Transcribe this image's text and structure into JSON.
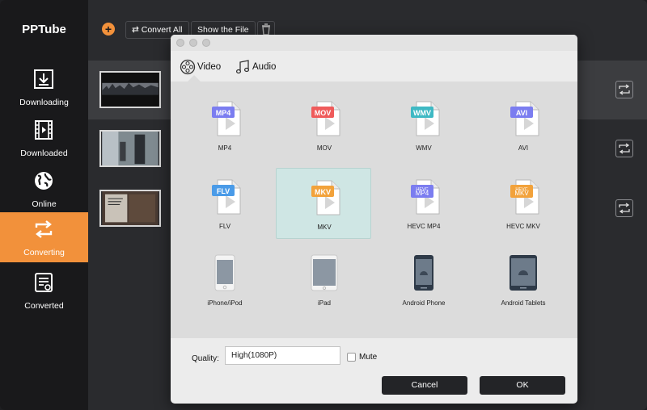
{
  "app": {
    "title": "PPTube"
  },
  "sidebar": {
    "items": [
      {
        "label": "Downloading"
      },
      {
        "label": "Downloaded"
      },
      {
        "label": "Online"
      },
      {
        "label": "Converting"
      },
      {
        "label": "Converted"
      }
    ],
    "active_index": 3
  },
  "toolbar": {
    "convert_all_label": "Convert All",
    "show_file_label": "Show the File"
  },
  "dialog": {
    "tabs": [
      {
        "label": "Video"
      },
      {
        "label": "Audio"
      }
    ],
    "formats": [
      {
        "badge": "MP4",
        "label": "MP4",
        "color": "#7b7df0"
      },
      {
        "badge": "MOV",
        "label": "MOV",
        "color": "#ef5b5b"
      },
      {
        "badge": "WMV",
        "label": "WMV",
        "color": "#3fb9c4"
      },
      {
        "badge": "AVI",
        "label": "AVI",
        "color": "#7b7df0"
      },
      {
        "badge": "FLV",
        "label": "FLV",
        "color": "#4a9be8"
      },
      {
        "badge": "MKV",
        "label": "MKV",
        "color": "#f2a23b"
      },
      {
        "badge": "HEVC MP4",
        "label": "HEVC MP4",
        "color": "#7b7df0"
      },
      {
        "badge": "HEVC MKV",
        "label": "HEVC MKV",
        "color": "#f2a23b"
      }
    ],
    "devices": [
      {
        "label": "iPhone/iPod"
      },
      {
        "label": "iPad"
      },
      {
        "label": "Android Phone"
      },
      {
        "label": "Android Tablets"
      }
    ],
    "selected_format": "MKV",
    "quality_label": "Quality:",
    "quality_value": "High(1080P)",
    "mute_label": "Mute",
    "mute_checked": false,
    "cancel_label": "Cancel",
    "ok_label": "OK"
  },
  "colors": {
    "accent": "#f2913b",
    "selected_tile": "#cfe6e4"
  }
}
